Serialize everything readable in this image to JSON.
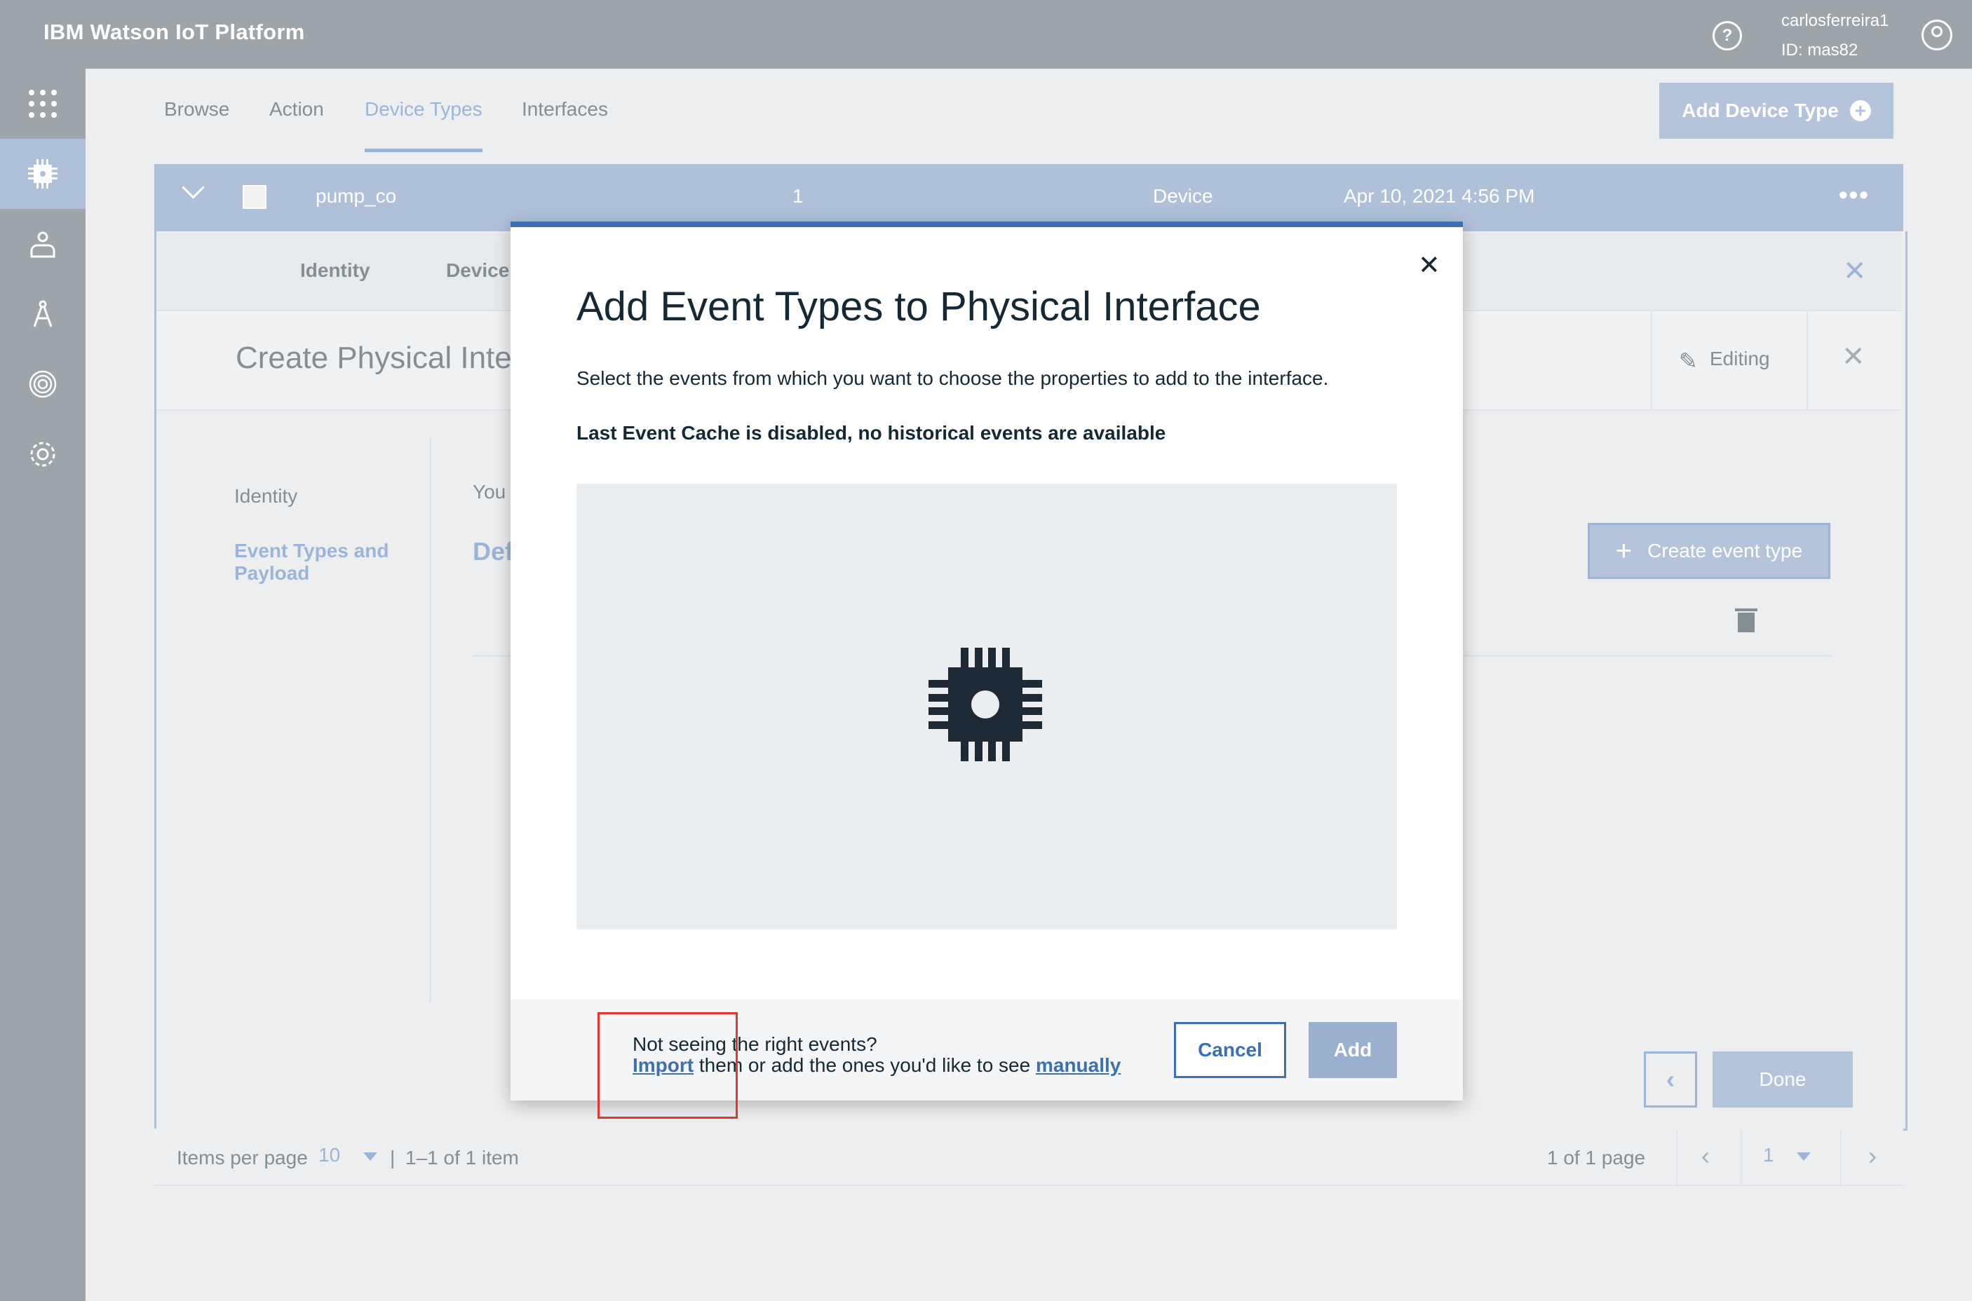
{
  "topbar": {
    "app_title": "IBM Watson IoT Platform",
    "help_icon": "?",
    "user_name": "carlosferreira1",
    "user_id": "ID: mas82"
  },
  "leftnav": {
    "items": [
      {
        "name": "apps-grid-icon",
        "glyph": "⋮⋮⋮"
      },
      {
        "name": "chip-icon",
        "glyph": "",
        "active": true
      },
      {
        "name": "members-icon",
        "glyph": ""
      },
      {
        "name": "compass-icon",
        "glyph": ""
      },
      {
        "name": "fingerprint-icon",
        "glyph": ""
      },
      {
        "name": "settings-icon",
        "glyph": ""
      }
    ]
  },
  "tabs": [
    "Browse",
    "Action",
    "Device Types",
    "Interfaces"
  ],
  "active_tab": "Device Types",
  "add_device_type_label": "Add Device Type",
  "device_row": {
    "name": "pump_co",
    "count": "1",
    "class": "Device",
    "date": "Apr 10, 2021 4:56 PM"
  },
  "subtabs": [
    "Identity",
    "Device"
  ],
  "create_pi_title": "Create Physical Inte",
  "editing_label": "Editing",
  "steps": {
    "identity": "Identity",
    "event_types": "Event Types and Payload"
  },
  "fragments": {
    "you": "You",
    "def": "Def"
  },
  "create_event_type_label": "Create event type",
  "done_label": "Done",
  "pagination": {
    "items_per_page_label": "Items per page",
    "page_size": "10",
    "item_range": "1–1 of 1 item",
    "page_info": "1 of 1 page",
    "current_page": "1"
  },
  "modal": {
    "title": "Add Event Types to Physical Interface",
    "description": "Select the events from which you want to choose the properties to add to the interface.",
    "warning": "Last Event Cache is disabled, no historical events are available",
    "footer_line1": "Not seeing the right events?",
    "import_link": "Import",
    "footer_middle": " them or add the ones you'd like to see ",
    "manually_link": "manually",
    "cancel_label": "Cancel",
    "add_label": "Add"
  },
  "colors": {
    "accent": "#3d70b2",
    "highlight": "#e0382c",
    "topbar": "#7c868e",
    "disabled_button": "#9bb0cf"
  }
}
